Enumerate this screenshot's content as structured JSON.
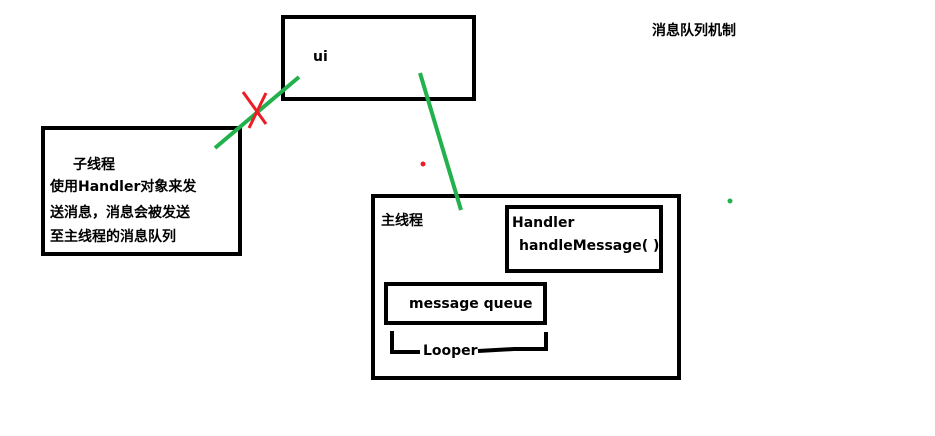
{
  "title": "消息队列机制",
  "ui_box": {
    "label": "ui"
  },
  "worker_thread": {
    "title": "子线程",
    "description_lines": [
      "使用Handler对象来发",
      "送消息，消息会被发送",
      "至主线程的消息队列"
    ]
  },
  "main_thread": {
    "title": "主线程",
    "handler": {
      "title": "Handler",
      "method": "handleMessage( )"
    },
    "message_queue": {
      "label": "message queue"
    },
    "looper": {
      "label": "Looper"
    }
  },
  "colors": {
    "box_border": "#000000",
    "connector": "#22b14c",
    "blocked_mark": "#ed1c24",
    "background": "#ffffff"
  }
}
